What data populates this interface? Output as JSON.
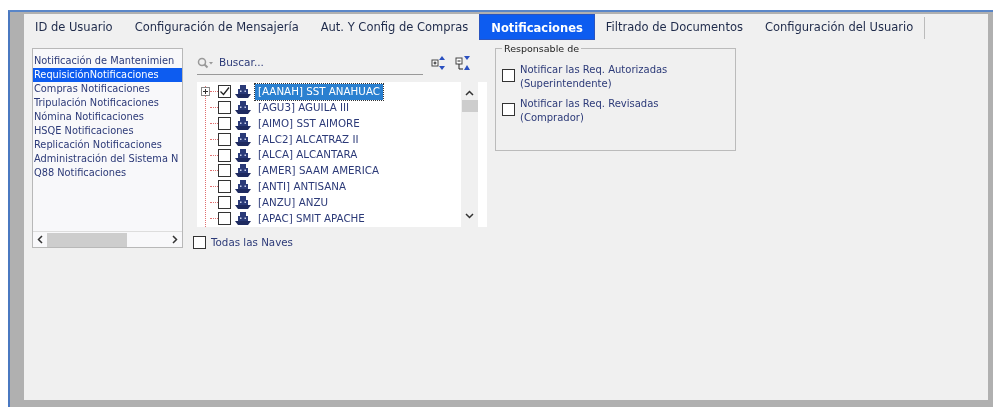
{
  "tabs": [
    {
      "label": "ID de Usuario",
      "selected": false
    },
    {
      "label": "Configuración de Mensajería",
      "selected": false
    },
    {
      "label": "Aut. Y Config de Compras",
      "selected": false
    },
    {
      "label": "Notificaciones",
      "selected": true
    },
    {
      "label": "Filtrado de Documentos",
      "selected": false
    },
    {
      "label": "Configuración del Usuario",
      "selected": false
    }
  ],
  "categories": [
    {
      "label": "Notificación de Mantenimien",
      "selected": false
    },
    {
      "label": "RequisiciónNotificaciones",
      "selected": true
    },
    {
      "label": "Compras Notificaciones",
      "selected": false
    },
    {
      "label": "Tripulación Notificaciones",
      "selected": false
    },
    {
      "label": "Nómina Notificaciones",
      "selected": false
    },
    {
      "label": "HSQE Notificaciones",
      "selected": false
    },
    {
      "label": "Replicación Notificaciones",
      "selected": false
    },
    {
      "label": "Administración del Sistema N",
      "selected": false
    },
    {
      "label": "Q88 Notificaciones",
      "selected": false
    }
  ],
  "search": {
    "placeholder": "Buscar..."
  },
  "vessels": [
    {
      "label": "[AANAH] SST ANAHUAC",
      "checked": true,
      "selected": true,
      "expandable": true
    },
    {
      "label": "[AGU3] AGUILA III",
      "checked": false,
      "selected": false,
      "expandable": false
    },
    {
      "label": "[AIMO] SST AIMORE",
      "checked": false,
      "selected": false,
      "expandable": false
    },
    {
      "label": "[ALC2] ALCATRAZ II",
      "checked": false,
      "selected": false,
      "expandable": false
    },
    {
      "label": "[ALCA] ALCANTARA",
      "checked": false,
      "selected": false,
      "expandable": false
    },
    {
      "label": "[AMER] SAAM AMERICA",
      "checked": false,
      "selected": false,
      "expandable": false
    },
    {
      "label": "[ANTI] ANTISANA",
      "checked": false,
      "selected": false,
      "expandable": false
    },
    {
      "label": "[ANZU] ANZU",
      "checked": false,
      "selected": false,
      "expandable": false
    },
    {
      "label": "[APAC] SMIT APACHE",
      "checked": false,
      "selected": false,
      "expandable": false
    }
  ],
  "all_vessels": {
    "label": "Todas las Naves",
    "checked": false
  },
  "responsible_group": {
    "title": "Responsable de",
    "options": [
      {
        "label": "Notificar las Req. Autorizadas (Superintendente)",
        "checked": false
      },
      {
        "label": "Notificar las Req. Revisadas (Comprador)",
        "checked": false
      }
    ]
  }
}
